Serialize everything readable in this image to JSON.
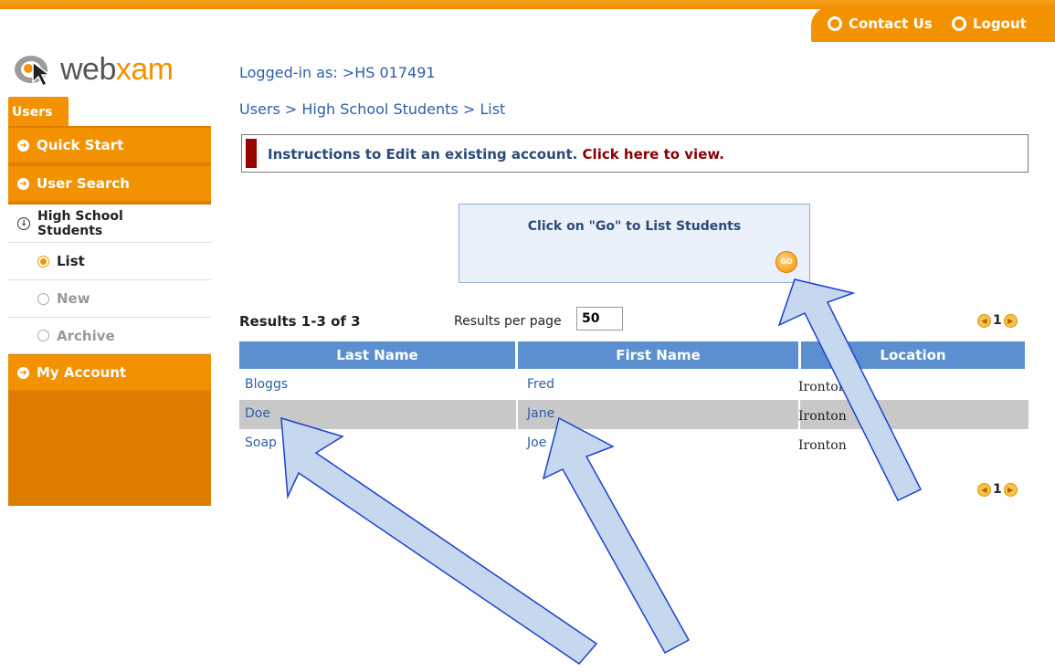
{
  "topnav": {
    "contact": "Contact Us",
    "logout": "Logout"
  },
  "logo": {
    "web": "web",
    "xam": "xam"
  },
  "sidebar": {
    "tab": "Users",
    "items": [
      {
        "label": "Quick Start"
      },
      {
        "label": "User Search"
      },
      {
        "label": "High School Students"
      },
      {
        "label": "List"
      },
      {
        "label": "New"
      },
      {
        "label": "Archive"
      },
      {
        "label": "My Account"
      }
    ]
  },
  "main": {
    "logged_in": "Logged-in as: >HS 017491",
    "breadcrumb": "Users > High School Students > List",
    "instructions": {
      "text": "Instructions to Edit an existing account. ",
      "link": "Click here to view."
    },
    "go_box": {
      "text": "Click on \"Go\" to List Students",
      "button": "GO"
    },
    "results": "Results 1-3 of 3",
    "rpp_label": "Results per page",
    "rpp_value": "50",
    "page": "1",
    "table": {
      "headers": [
        "Last Name",
        "First Name",
        "Location"
      ],
      "rows": [
        {
          "last": "Bloggs",
          "first": "Fred",
          "location": "Ironton"
        },
        {
          "last": "Doe",
          "first": "Jane",
          "location": "Ironton"
        },
        {
          "last": "Soap",
          "first": "Joe",
          "location": "Ironton"
        }
      ]
    }
  },
  "colors": {
    "brand_orange": "#f39200",
    "header_blue": "#5b8fd0",
    "link_blue": "#2c5fa8",
    "arrow_fill": "#c5d8ee",
    "arrow_stroke": "#1e3fd0"
  }
}
